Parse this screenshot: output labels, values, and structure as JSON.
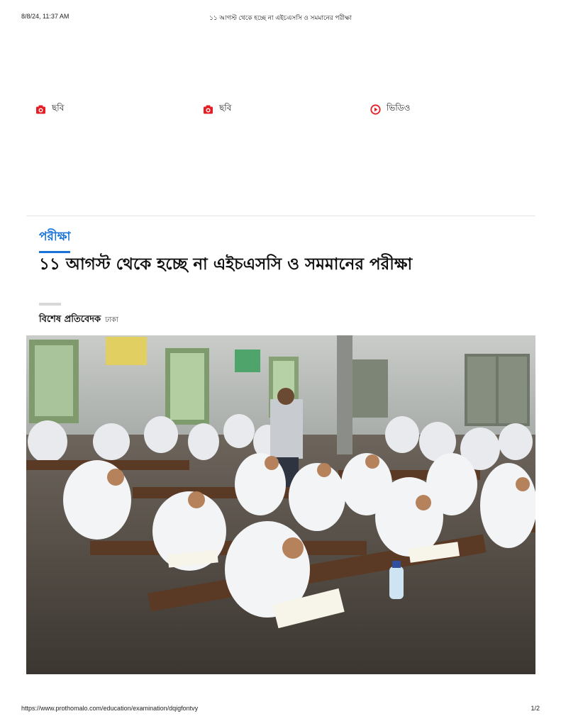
{
  "print_header": {
    "datetime": "8/8/24, 11:37 AM",
    "page_title": "১১ আগস্ট থেকে হচ্ছে না এইচএসসি ও সমমানের পরীক্ষা"
  },
  "media_tabs": [
    {
      "label": "ছবি",
      "icon": "camera-icon"
    },
    {
      "label": "ছবি",
      "icon": "camera-icon"
    },
    {
      "label": "ভিডিও",
      "icon": "play-circle-icon"
    }
  ],
  "article": {
    "category": "পরীক্ষা",
    "headline": "১১ আগস্ট থেকে হচ্ছে না এইচএসসি ও সমমানের পরীক্ষা",
    "author": "বিশেষ প্রতিবেদক",
    "location": "ঢাকা"
  },
  "print_footer": {
    "url": "https://www.prothomalo.com/education/examination/dqigfontvy",
    "page": "1/2"
  },
  "colors": {
    "accent_blue": "#1a73d9",
    "icon_red": "#e31e24"
  }
}
